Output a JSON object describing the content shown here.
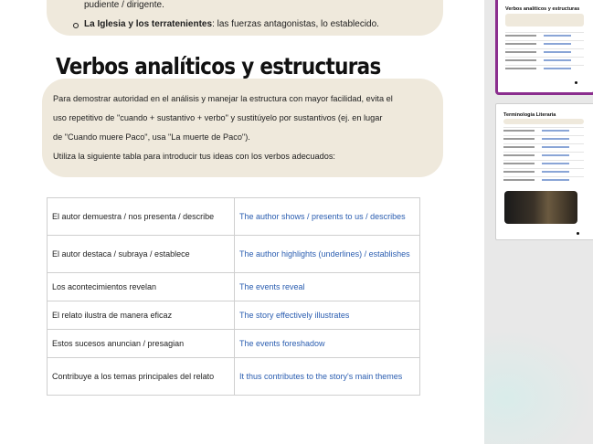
{
  "document": {
    "top_card": {
      "line1": "pudiente / dirigente.",
      "line2_bold": "La Iglesia y los terratenientes",
      "line2_rest": ": las fuerzas antagonistas, lo establecido."
    },
    "heading": "Verbos analíticos y estructuras",
    "intro": {
      "line1": "Para demostrar autoridad en el análisis y manejar la estructura con mayor facilidad, evita el",
      "line2": "uso repetitivo de \"cuando + sustantivo + verbo\" y sustitúyelo por sustantivos (ej. en lugar",
      "line3": "de \"Cuando muere Paco\", usa \"La muerte de Paco\").",
      "line4": "Utiliza la siguiente tabla para introducir tus ideas con los verbos adecuados:"
    },
    "table": [
      {
        "es": "El autor demuestra / nos presenta / describe",
        "en": "The author shows / presents to us / describes"
      },
      {
        "es": "El autor destaca / subraya / establece",
        "en": "The author highlights (underlines) / establishes"
      },
      {
        "es": "Los acontecimientos revelan",
        "en": "The events reveal"
      },
      {
        "es": "El relato ilustra de manera eficaz",
        "en": "The story effectively illustrates"
      },
      {
        "es": "Estos sucesos anuncian / presagian",
        "en": "The events foreshadow"
      },
      {
        "es": "Contribuye a los temas principales del relato",
        "en": "It thus contributes to the story's main themes"
      }
    ]
  },
  "thumbnails": [
    {
      "title": "Verbos analíticos y estructuras",
      "selected": true
    },
    {
      "title": "Terminología Literaria",
      "selected": false
    }
  ],
  "colors": {
    "card_bg": "#efe9dc",
    "link_blue": "#2a5db0",
    "selected_border": "#8b2e8e"
  }
}
